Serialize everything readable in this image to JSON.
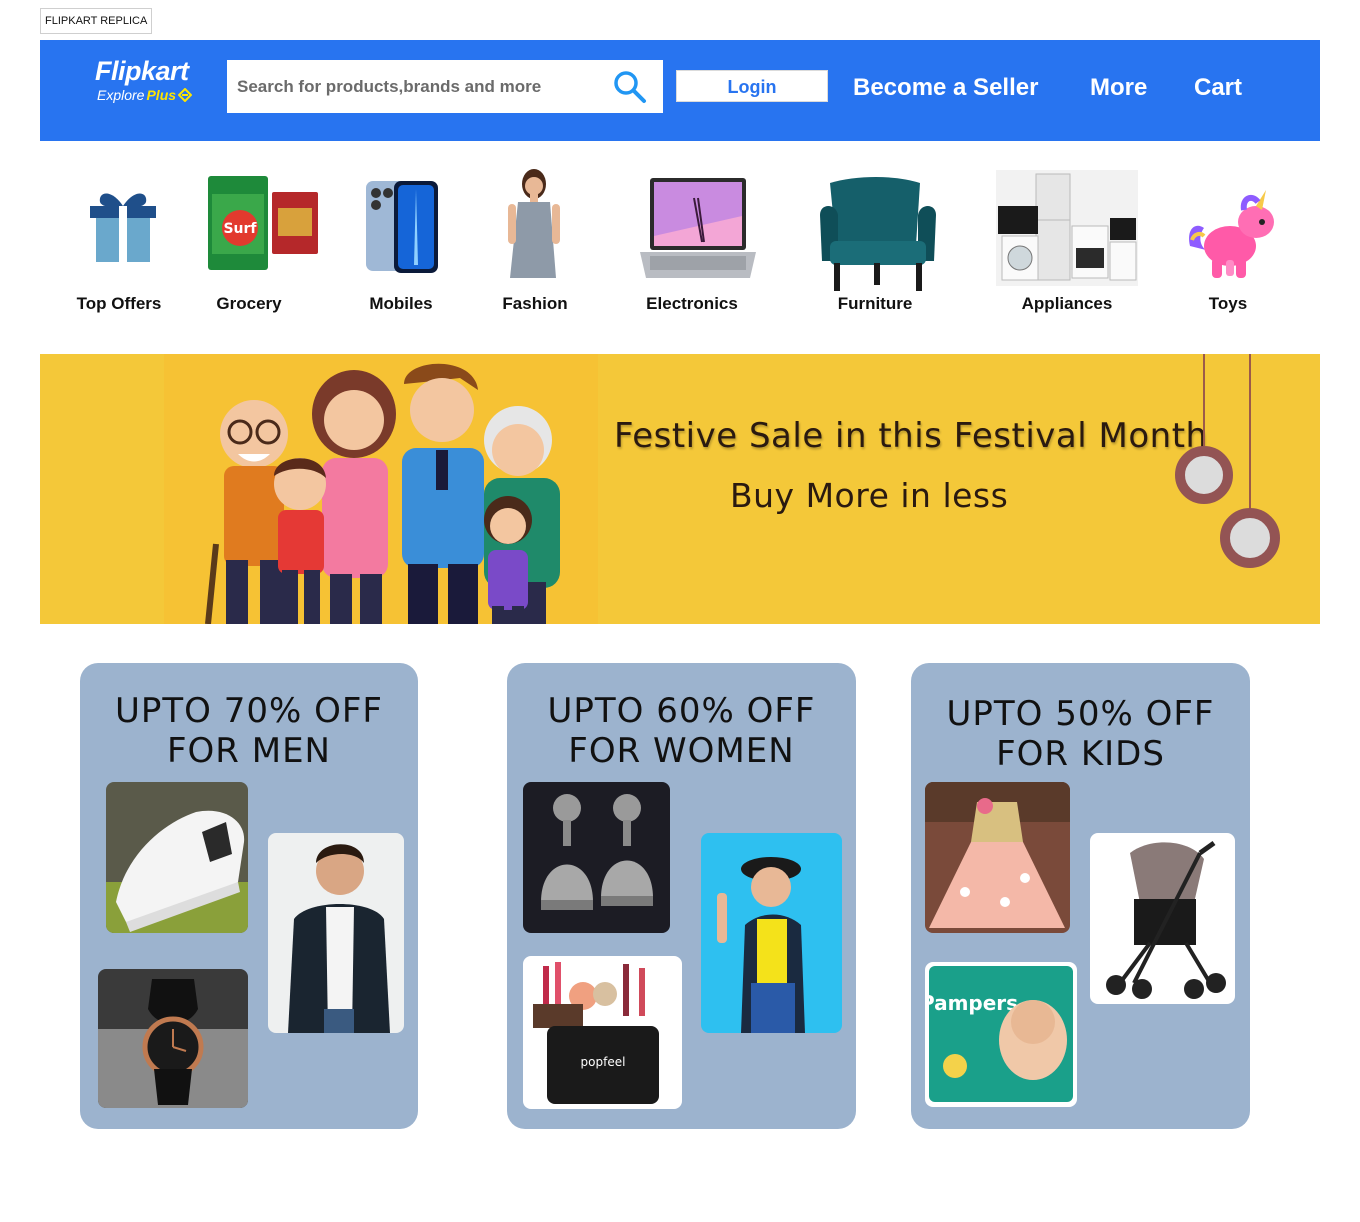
{
  "page_tag": "FLIPKART REPLICA",
  "header": {
    "logo_word": "Flipkart",
    "logo_sub_explore": "Explore",
    "logo_sub_plus": "Plus",
    "search_placeholder": "Search for products,brands and more",
    "login_label": "Login",
    "nav": {
      "seller": "Become a Seller",
      "more": "More",
      "cart": "Cart"
    },
    "colors": {
      "brand_blue": "#2874f0",
      "plus_yellow": "#ffe500"
    }
  },
  "categories": [
    {
      "label": "Top Offers",
      "icon": "gift-icon"
    },
    {
      "label": "Grocery",
      "icon": "grocery-icon"
    },
    {
      "label": "Mobiles",
      "icon": "mobile-icon"
    },
    {
      "label": "Fashion",
      "icon": "fashion-icon"
    },
    {
      "label": "Electronics",
      "icon": "laptop-icon"
    },
    {
      "label": "Furniture",
      "icon": "chair-icon"
    },
    {
      "label": "Appliances",
      "icon": "appliances-icon"
    },
    {
      "label": "Toys",
      "icon": "toy-unicorn-icon"
    }
  ],
  "banner": {
    "line1": "Festive Sale in this Festival Month",
    "line2": "Buy More in less",
    "background": "#f4c839"
  },
  "offers": [
    {
      "line1": "UPTO 70% OFF",
      "line2": "FOR MEN",
      "items": [
        "sneaker-image",
        "jacket-model-image",
        "watch-image"
      ]
    },
    {
      "line1": "UPTO 60% OFF",
      "line2": "FOR WOMEN",
      "items": [
        "earrings-image",
        "woman-model-image",
        "makeup-kit-image"
      ]
    },
    {
      "line1": "UPTO 50% OFF",
      "line2": "FOR KIDS",
      "items": [
        "kids-dress-image",
        "stroller-image",
        "diapers-image"
      ]
    }
  ],
  "card_color": "#9cb3ce"
}
